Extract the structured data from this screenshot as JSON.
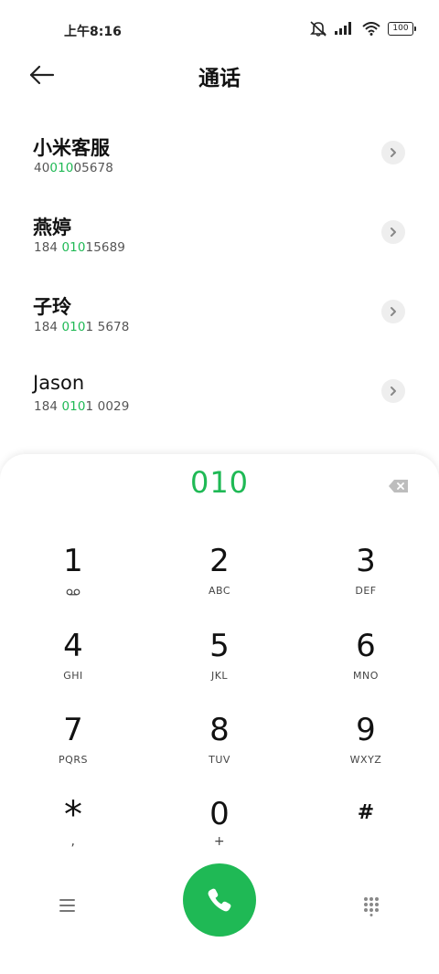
{
  "status_bar": {
    "time": "上午8:16",
    "battery": "100",
    "icons": [
      "mute-bell-icon",
      "signal-icon",
      "wifi-icon",
      "battery-icon"
    ]
  },
  "header": {
    "title": "通话"
  },
  "contacts": [
    {
      "name": "小米客服",
      "num_pre": "40",
      "num_match": "010",
      "num_post": "05678"
    },
    {
      "name": "燕婷",
      "num_pre": "184 ",
      "num_match": "010",
      "num_post": "15689"
    },
    {
      "name": "子玲",
      "num_pre": "184 ",
      "num_match": "010",
      "num_post": "1 5678"
    },
    {
      "name": "Jason",
      "num_pre": "184 ",
      "num_match": "010",
      "num_post": "1 0029"
    }
  ],
  "dialer": {
    "typed_number": "010",
    "keys": [
      {
        "digit": "1",
        "letters": ""
      },
      {
        "digit": "2",
        "letters": "ABC"
      },
      {
        "digit": "3",
        "letters": "DEF"
      },
      {
        "digit": "4",
        "letters": "GHI"
      },
      {
        "digit": "5",
        "letters": "JKL"
      },
      {
        "digit": "6",
        "letters": "MNO"
      },
      {
        "digit": "7",
        "letters": "PQRS"
      },
      {
        "digit": "8",
        "letters": "TUV"
      },
      {
        "digit": "9",
        "letters": "WXYZ"
      },
      {
        "digit": "*",
        "letters": ","
      },
      {
        "digit": "0",
        "letters": "+"
      },
      {
        "digit": "#",
        "letters": ""
      }
    ]
  },
  "colors": {
    "accent": "#1fb955"
  }
}
